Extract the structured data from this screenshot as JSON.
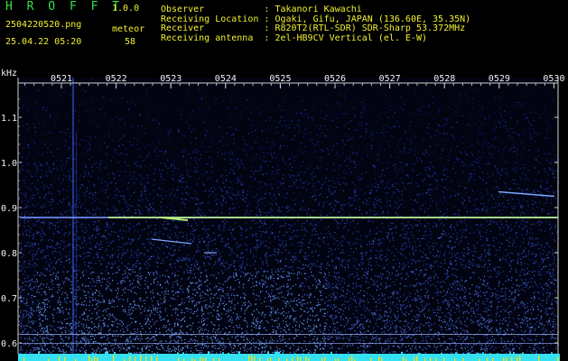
{
  "header": {
    "app_title": "H R O F F T",
    "app_version": "1.0.0",
    "file_name": "2504220520.png",
    "date_time": "25.04.22 05:20",
    "meteor_label": "meteor",
    "meteor_count": "58",
    "info": [
      {
        "key": "Observer",
        "value": "Takanori Kawachi"
      },
      {
        "key": "Receiving Location",
        "value": "Ogaki, Gifu, JAPAN (136.60E, 35.35N)"
      },
      {
        "key": "Receiver",
        "value": "R820T2(RTL-SDR) SDR-Sharp 53.372MHz"
      },
      {
        "key": "Receiving antenna",
        "value": "2el-HB9CV Vertical (el. E-W)"
      }
    ]
  },
  "spectrogram": {
    "y_unit": "kHz",
    "y_ticks": [
      "1.1",
      "1.0",
      "0.9",
      "0.8",
      "0.7",
      "0.6"
    ],
    "x_ticks": [
      "0521",
      "0522",
      "0523",
      "0524",
      "0525",
      "0526",
      "0527",
      "0528",
      "0529",
      "0530"
    ],
    "colors": {
      "background": "#000000",
      "noise_low": "#0a1a9a",
      "noise_high": "#6fa8ff",
      "carrier": "#b8f07a",
      "baseline": "#35e0f0",
      "baseline_peak": "#f0e020"
    }
  }
}
